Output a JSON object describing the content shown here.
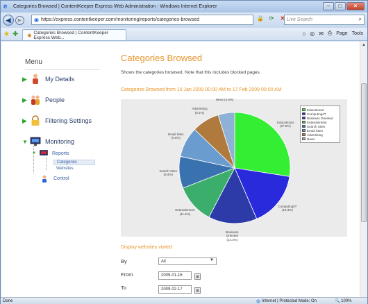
{
  "window": {
    "title": "Categories Browsed | ContentKeeper Express Web Administration - Windows Internet Explorer"
  },
  "address": {
    "url": "https://express.contentkeeper.com/monitoring/reports/categories-browsed",
    "search_placeholder": "Live Search"
  },
  "tabs": [
    {
      "label": "Categories Browsed | ContentKeeper Express Web..."
    }
  ],
  "command_bar": {
    "page_label": "Page",
    "tools_label": "Tools"
  },
  "sidebar": {
    "title": "Menu",
    "items": [
      {
        "label": "My Details",
        "icon": "user-icon"
      },
      {
        "label": "People",
        "icon": "people-icon"
      },
      {
        "label": "Filtering Settings",
        "icon": "lock-icon"
      },
      {
        "label": "Monitoring",
        "icon": "monitor-icon"
      }
    ],
    "monitoring_children": [
      {
        "label": "Reports",
        "icon": "reports-icon"
      },
      {
        "label": "Control",
        "icon": "control-icon"
      }
    ],
    "report_children": [
      "Categories",
      "Websites"
    ]
  },
  "main": {
    "title": "Categories Browsed",
    "description": "Shows the categories browsed. Note that this includes blocked pages.",
    "range_title": "Categories Browsed from 16 Jan 2009 00:00 AM to 17 Feb 2009 00:00 AM",
    "visited_title": "Display websites visited",
    "form": {
      "by_label": "By",
      "by_value": "All",
      "from_label": "From",
      "from_value": "2009-01-16",
      "to_label": "To",
      "to_value": "2009-02-17"
    }
  },
  "chart_data": {
    "type": "pie",
    "title": "",
    "legend_position": "top-right",
    "slices": [
      {
        "name": "Educational",
        "value": 27.9,
        "color": "#33ee33",
        "label": "Educational\n(27.9%)"
      },
      {
        "name": "Computing/IT",
        "value": 16.3,
        "color": "#2a2add",
        "label": "Computing/IT\n(16.3%)"
      },
      {
        "name": "Business Oriented",
        "value": 14.4,
        "color": "#2c3ba8",
        "label": "Business\nOriented\n(14.4%)"
      },
      {
        "name": "Entertainment",
        "value": 11.6,
        "color": "#3cae6c",
        "label": "Entertainment\n(11.6%)"
      },
      {
        "name": "Search Sites",
        "value": 9.4,
        "color": "#3a72b0",
        "label": "Search Sites\n(9.4%)"
      },
      {
        "name": "Email Sites",
        "value": 9.0,
        "color": "#6a9ccf",
        "label": "Email Sites\n(9.0%)"
      },
      {
        "name": "Advertising",
        "value": 8.1,
        "color": "#b07a3e",
        "label": "Advertising\n(8.1%)"
      },
      {
        "name": "News",
        "value": 4.9,
        "color": "#8fb1d6",
        "label": "News (4.9%)"
      }
    ]
  },
  "status": {
    "left": "Done",
    "zone": "Internet | Protected Mode: On",
    "zoom": "100%"
  }
}
